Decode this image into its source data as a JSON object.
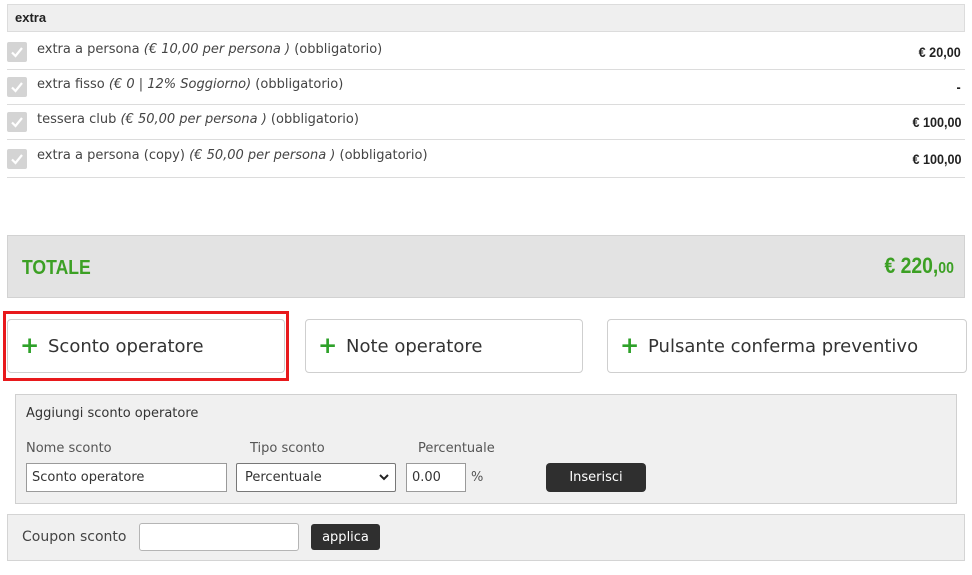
{
  "extra": {
    "header": "extra",
    "items": [
      {
        "name": "extra a persona",
        "detail": "(€ 10,00 per persona )",
        "required": "(obbligatorio)",
        "price": "€ 20,00"
      },
      {
        "name": "extra fisso",
        "detail": "(€ 0 | 12% Soggiorno)",
        "required": "(obbligatorio)",
        "price": "-"
      },
      {
        "name": "tessera club",
        "detail": "(€ 50,00 per persona )",
        "required": "(obbligatorio)",
        "price": "€ 100,00"
      },
      {
        "name": "extra a persona (copy)",
        "detail": "(€ 50,00 per persona )",
        "required": "(obbligatorio)",
        "price": "€ 100,00"
      }
    ]
  },
  "totale": {
    "label": "TOTALE",
    "value_int": "€ 220,",
    "value_dec": "00"
  },
  "operator_buttons": {
    "plus": "+",
    "sconto": "Sconto operatore",
    "note": "Note operatore",
    "conferma": "Pulsante conferma preventivo"
  },
  "discount_panel": {
    "title": "Aggiungi sconto operatore",
    "name_label": "Nome sconto",
    "name_value": "Sconto operatore",
    "type_label": "Tipo sconto",
    "type_value": "Percentuale",
    "pct_label": "Percentuale",
    "pct_value": "0.00",
    "pct_symbol": "%",
    "insert_button": "Inserisci"
  },
  "coupon": {
    "label": "Coupon sconto",
    "value": "",
    "apply_button": "applica"
  },
  "colors": {
    "accent_green": "#3ca024",
    "highlight_red": "#e8191c",
    "dark_button": "#2f2f2f"
  }
}
